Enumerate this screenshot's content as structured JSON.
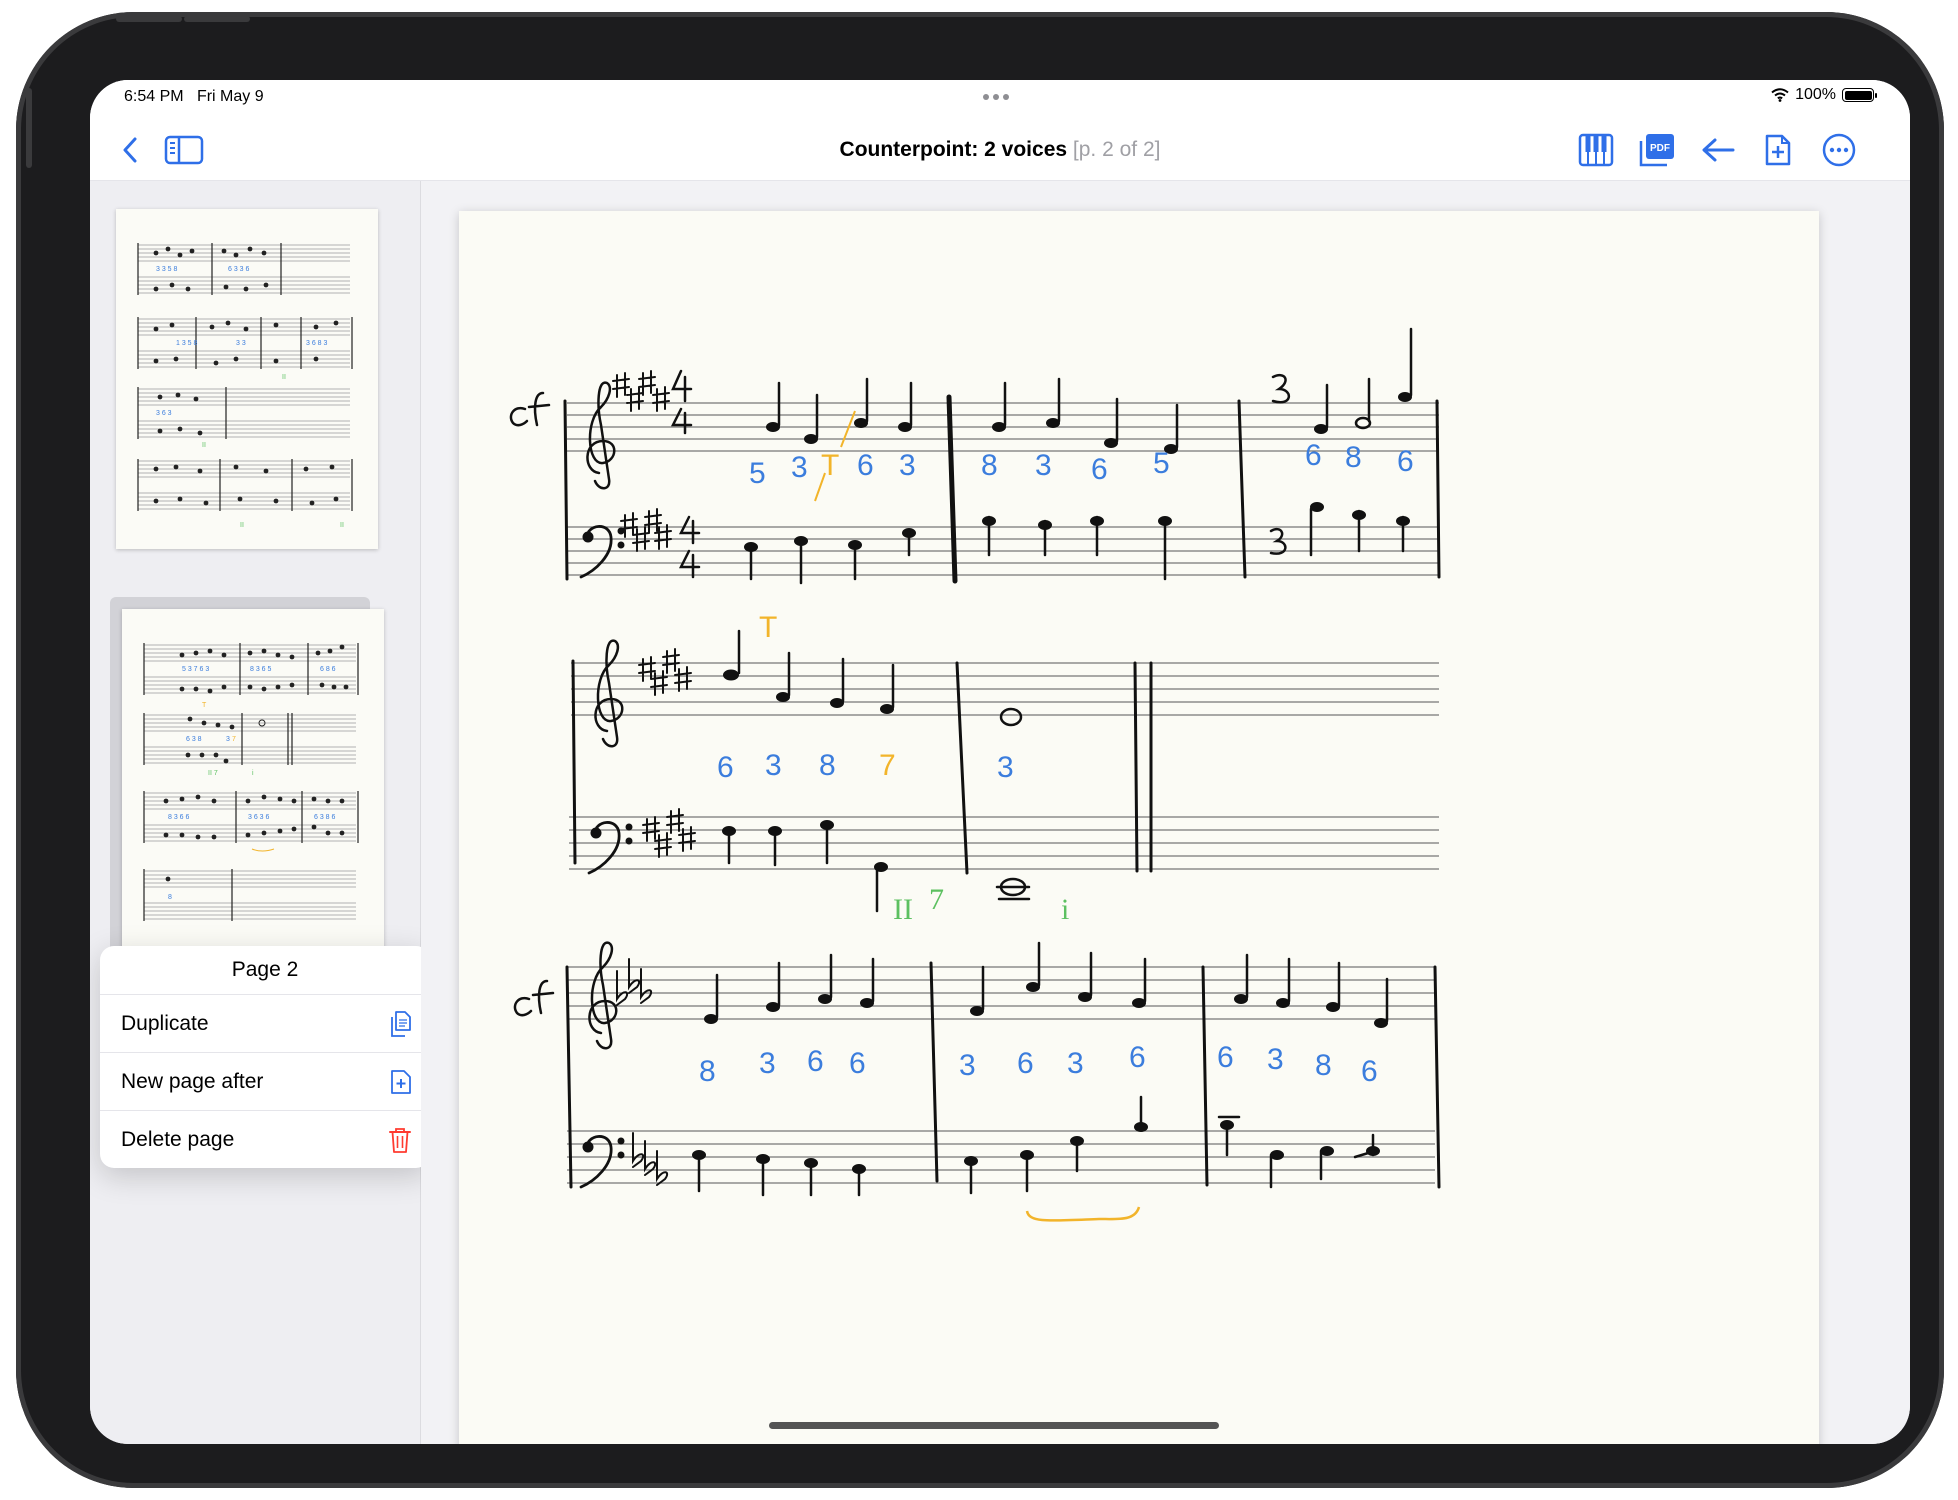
{
  "status_bar": {
    "time": "6:54 PM",
    "date": "Fri May 9",
    "battery_percent": "100%"
  },
  "nav": {
    "title": "Counterpoint: 2 voices",
    "page_info": "[p. 2 of 2]",
    "icons": [
      "back-chevron-icon",
      "sidebar-toggle-icon",
      "piano-keyboard-icon",
      "pdf-export-icon",
      "undo-arrow-icon",
      "add-page-icon",
      "more-options-icon"
    ]
  },
  "sidebar": {
    "thumbnails": [
      "page-1",
      "page-2"
    ],
    "selected_index": 1
  },
  "context_menu": {
    "title": "Page 2",
    "items": [
      {
        "label": "Duplicate",
        "icon": "duplicate-icon"
      },
      {
        "label": "New page after",
        "icon": "add-page-icon"
      },
      {
        "label": "Delete page",
        "icon": "trash-icon"
      }
    ],
    "colors": {
      "accent": "#2f6fe8",
      "destructive": "#ff3b30"
    }
  },
  "score": {
    "cf_label": "cf",
    "time_signature": [
      "4",
      "4"
    ],
    "system1": {
      "cadence_marks": [
        "3",
        "3"
      ],
      "figures_blue": [
        "5",
        "3",
        "6",
        "3",
        "8",
        "3",
        "6",
        "5",
        "6",
        "8",
        "6"
      ],
      "figures_yellow": [
        "T"
      ]
    },
    "system2": {
      "figures_blue": [
        "6",
        "3",
        "8",
        "3"
      ],
      "figures_yellow": [
        "T",
        "7"
      ],
      "figures_green": [
        "II",
        "7",
        "i"
      ]
    },
    "system3": {
      "figures_blue": [
        "8",
        "3",
        "6",
        "6",
        "3",
        "6",
        "3",
        "6",
        "6",
        "3",
        "8",
        "6"
      ]
    },
    "ink_colors": {
      "black": "#111111",
      "blue": "#3b7ddd",
      "yellow": "#f2b42a",
      "green": "#5cc060"
    }
  }
}
